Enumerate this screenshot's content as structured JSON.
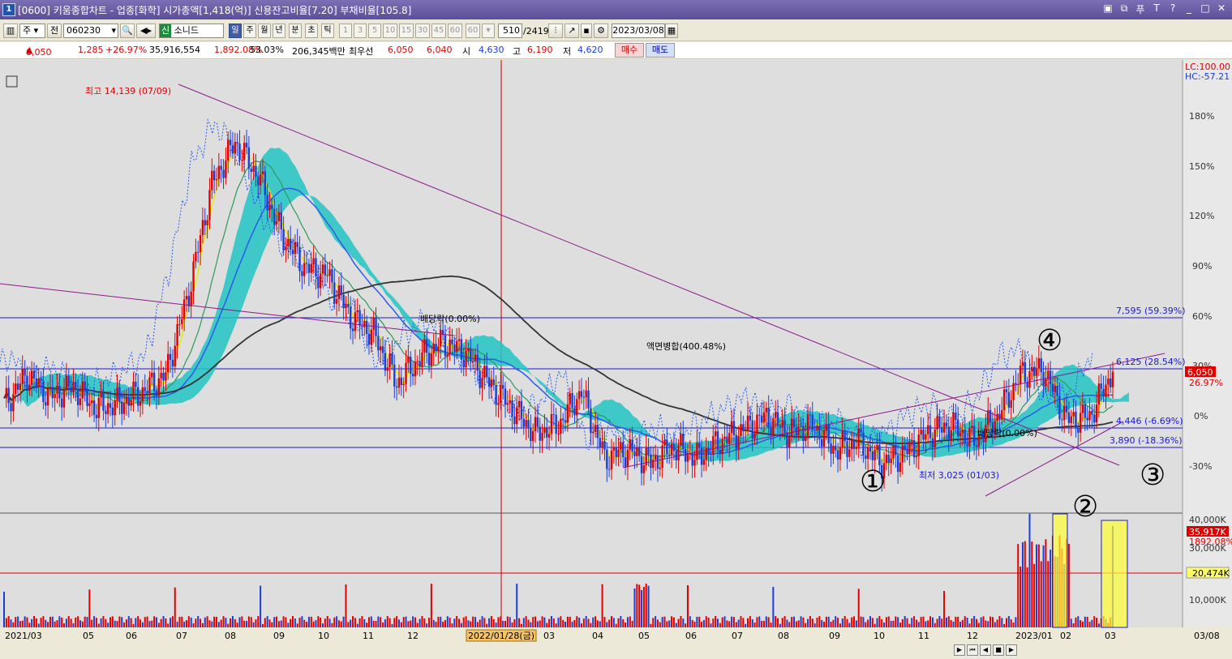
{
  "window": {
    "number": "1",
    "title": "[0600] 키움종합차트 - 업종[화학] 시가총액[1,418(억)] 신용잔고비율[7.20] 부채비율[105.8]",
    "buttons": [
      "▣",
      "⧉",
      "푸",
      "T",
      "?",
      "_",
      "□",
      "✕"
    ]
  },
  "toolbar": {
    "period_type": "주",
    "prev_label": "전",
    "code": "060230",
    "stock_name": "소니드",
    "market_badge": "신",
    "periods": [
      "일",
      "주",
      "월",
      "년",
      "분",
      "초",
      "틱"
    ],
    "active_period": "일",
    "minute_buttons": [
      "1",
      "3",
      "5",
      "10",
      "15",
      "30",
      "45",
      "60",
      "60"
    ],
    "count": "510",
    "total": "/2419",
    "date": "2023/03/08"
  },
  "quote": {
    "price": "6,050",
    "change": "1,285",
    "change_pct": "+26.97%",
    "volume": "35,916,554",
    "volume_ratio": "1,892.08%",
    "rate": "53.03%",
    "amount": "206,345백만",
    "priority_label": "최우선",
    "best_ask": "6,050",
    "best_bid": "6,040",
    "open_label": "시",
    "open": "4,630",
    "high_label": "고",
    "high": "6,190",
    "low_label": "저",
    "low": "4,620",
    "buy_label": "매수",
    "sell_label": "매도"
  },
  "colors": {
    "up": "#e00000",
    "down": "#1a3ed8",
    "cloud": "#22c4c4",
    "ma5": "#e8e800",
    "ma20": "#2e9a5a",
    "ma60": "#2b5be8",
    "ma120": "#333333",
    "trend": "#8a1a8a",
    "background": "#dcdcdc"
  },
  "chart": {
    "lc_label": "LC:100.00",
    "hc_label": "HC:-57.21",
    "max_label": "최고 14,139 (07/09)",
    "min_label": "최저 3,025 (01/03)",
    "event1": "액면병합(400.48%)",
    "event2": "배당락(0.00%)",
    "event3": "배당락(0.00%)",
    "hline1": "7,595 (59.39%)",
    "hline2": "6,125 (28.54%)",
    "hline3": "4,446 (-6.69%)",
    "hline4": "3,890 (-18.36%)",
    "current_price_tag": "6,050",
    "current_pct_tag": "26.97%",
    "markers": [
      "①",
      "②",
      "③",
      "④"
    ],
    "y_ticks": [
      "180%",
      "150%",
      "120%",
      "90%",
      "60%",
      "30%",
      "0%",
      "-30%"
    ],
    "volume_ticks": [
      "40,000K",
      "30,000K",
      "10,000K"
    ],
    "volume_current": "35,917K",
    "volume_ratio": "1892.08%",
    "volume_ma": "20,474K",
    "x_labels": [
      "2021/03",
      "05",
      "06",
      "07",
      "08",
      "09",
      "10",
      "11",
      "12",
      "2022/01/28(금)",
      "03",
      "04",
      "05",
      "06",
      "07",
      "08",
      "09",
      "10",
      "11",
      "12",
      "2023/01",
      "02",
      "03",
      "03/08"
    ],
    "x_cursor": "2022/01/28(금)"
  },
  "chart_data": {
    "type": "candlestick",
    "title": "",
    "xlabel": "",
    "ylabel": "",
    "ylim_pct": [
      -57.21,
      100
    ],
    "price_levels": [
      {
        "price": 7595,
        "pct": 59.39
      },
      {
        "price": 6125,
        "pct": 28.54
      },
      {
        "price": 4446,
        "pct": -6.69
      },
      {
        "price": 3890,
        "pct": -18.36
      }
    ],
    "high": {
      "price": 14139,
      "date": "07/09"
    },
    "low": {
      "price": 3025,
      "date": "01/03"
    },
    "last": {
      "price": 6050,
      "pct": 26.97
    },
    "series": [
      {
        "name": "close_pct",
        "values": [
          7,
          25,
          12,
          18,
          5,
          8,
          15,
          25,
          75,
          140,
          165,
          145,
          110,
          90,
          85,
          60,
          50,
          20,
          35,
          45,
          38,
          20,
          5,
          -10,
          -5,
          15,
          -25,
          -20,
          -28,
          -18,
          -25,
          -15,
          -8,
          0,
          -10,
          -5,
          -20,
          -15,
          -28,
          -22,
          -10,
          -5,
          -15,
          0,
          25,
          28,
          -2,
          0,
          26.97
        ]
      }
    ],
    "volume": {
      "current_k": 35917,
      "ma_k": 20474
    }
  }
}
